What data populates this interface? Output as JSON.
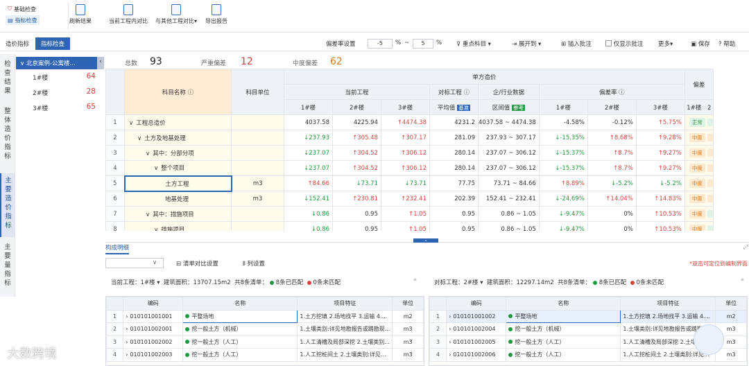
{
  "ribbon": {
    "tabs": [
      {
        "label": "基础检查",
        "active": false
      },
      {
        "label": "指标检查",
        "active": true
      }
    ],
    "buttons": [
      "刷新结果",
      "当前工程内对比",
      "与其他工程对比",
      "导出报告"
    ]
  },
  "toolbar": {
    "tab_cost": "造价指标",
    "tab_check": "指标检查",
    "deviation_label": "偏差率设置",
    "dev_from": "-5",
    "dev_to": "5",
    "pct": "%",
    "tilde": "~",
    "key_subject": "重点科目",
    "expand_to": "展开到",
    "insert_note": "插入批注",
    "only_show_note": "仅显示批注",
    "more": "更多",
    "save": "保存",
    "help": "帮助"
  },
  "left_tabs": [
    "检查结果",
    "整体造价指标",
    "主要造价指标",
    "主要量指标"
  ],
  "tree": {
    "project": "北京案例-公寓楼...",
    "items": [
      {
        "name": "1#楼",
        "count": "64"
      },
      {
        "name": "2#楼",
        "count": "28"
      },
      {
        "name": "3#楼",
        "count": "65"
      }
    ]
  },
  "stats": {
    "total_label": "总数",
    "total": "93",
    "serious_label": "严重偏差",
    "serious": "12",
    "moderate_label": "中度偏差",
    "moderate": "62"
  },
  "grid": {
    "headers": {
      "name": "科目名称",
      "unit": "科目单位",
      "unit_cost": "单方造价",
      "current": "当前工程",
      "compare": "对标工程",
      "industry": "企/行业数据",
      "deviation": "偏差率",
      "deviation2": "偏差",
      "b1": "1#楼",
      "b2": "2#楼",
      "b3": "3#楼",
      "avg": "平均值",
      "avg_badge": "基准",
      "range": "区间值",
      "range_badge": "参考",
      "b2b": "2"
    },
    "rows": [
      {
        "no": "1",
        "indent": 0,
        "exp": "∨",
        "name": "工程总造价",
        "unit": "",
        "c1": "4037.58",
        "c1d": "",
        "c2": "4225.94",
        "c2d": "",
        "c3": "4474.38",
        "c3d": "up",
        "avg": "4231.2",
        "range": "4037.58 ~ 4474.38",
        "r1": "-4.58%",
        "r1d": "",
        "r2": "-0.12%",
        "r2d": "",
        "r3": "5.75%",
        "r3d": "up",
        "tag": "正常",
        "tagc": "ok",
        "extra": "ok"
      },
      {
        "no": "2",
        "indent": 1,
        "exp": "∨",
        "name": "土方及地基处理",
        "unit": "",
        "c1": "237.93",
        "c1d": "dn",
        "c2": "305.48",
        "c2d": "up",
        "c3": "307.17",
        "c3d": "up",
        "avg": "281.09",
        "range": "237.93 ~ 307.17",
        "r1": "-15.35%",
        "r1d": "dn",
        "r2": "8.68%",
        "r2d": "up",
        "r3": "9.28%",
        "r3d": "up",
        "tag": "中度",
        "tagc": "mid",
        "extra": "mid"
      },
      {
        "no": "3",
        "indent": 2,
        "exp": "∨",
        "name": "其中：分部分项",
        "unit": "",
        "c1": "237.07",
        "c1d": "dn",
        "c2": "304.52",
        "c2d": "up",
        "c3": "306.12",
        "c3d": "up",
        "avg": "280.14",
        "range": "237.07 ~ 306.12",
        "r1": "-15.37%",
        "r1d": "dn",
        "r2": "8.7%",
        "r2d": "up",
        "r3": "9.27%",
        "r3d": "up",
        "tag": "中度",
        "tagc": "mid",
        "extra": "mid"
      },
      {
        "no": "4",
        "indent": 3,
        "exp": "∨",
        "name": "整个项目",
        "unit": "",
        "c1": "237.07",
        "c1d": "dn",
        "c2": "304.52",
        "c2d": "up",
        "c3": "306.12",
        "c3d": "up",
        "avg": "280.14",
        "range": "237.07 ~ 306.12",
        "r1": "-15.37%",
        "r1d": "dn",
        "r2": "8.7%",
        "r2d": "up",
        "r3": "9.27%",
        "r3d": "up",
        "tag": "中度",
        "tagc": "mid",
        "extra": "mid"
      },
      {
        "no": "5",
        "indent": 4,
        "exp": "",
        "name": "土方工程",
        "unit": "m3",
        "c1": "84.66",
        "c1d": "up",
        "c2": "73.71",
        "c2d": "dn",
        "c3": "73.71",
        "c3d": "dn",
        "avg": "77.75",
        "range": "73.71 ~ 84.66",
        "r1": "8.89%",
        "r1d": "up",
        "r2": "-5.2%",
        "r2d": "dn",
        "r3": "-5.2%",
        "r3d": "dn",
        "tag": "中度",
        "tagc": "mid",
        "extra": "mid"
      },
      {
        "no": "6",
        "indent": 4,
        "exp": "",
        "name": "地基处理",
        "unit": "m3",
        "c1": "152.41",
        "c1d": "dn",
        "c2": "230.81",
        "c2d": "up",
        "c3": "232.41",
        "c3d": "up",
        "avg": "202.39",
        "range": "152.41 ~ 232.41",
        "r1": "-24.69%",
        "r1d": "dn",
        "r2": "14.04%",
        "r2d": "up",
        "r3": "14.83%",
        "r3d": "up",
        "tag": "中度",
        "tagc": "mid",
        "extra": "mid"
      },
      {
        "no": "7",
        "indent": 2,
        "exp": "∨",
        "name": "其中：措施项目",
        "unit": "",
        "c1": "0.86",
        "c1d": "dn",
        "c2": "0.95",
        "c2d": "",
        "c3": "1.05",
        "c3d": "up",
        "avg": "0.95",
        "range": "0.86 ~ 1.05",
        "r1": "-9.47%",
        "r1d": "dn",
        "r2": "0%",
        "r2d": "",
        "r3": "10.53%",
        "r3d": "up",
        "tag": "中度",
        "tagc": "mid",
        "extra": "ok"
      },
      {
        "no": "8",
        "indent": 3,
        "exp": "∨",
        "name": "措施项目",
        "unit": "",
        "c1": "0.86",
        "c1d": "dn",
        "c2": "0.95",
        "c2d": "",
        "c3": "1.05",
        "c3d": "up",
        "avg": "0.95",
        "range": "0.86 ~ 1.05",
        "r1": "-9.47%",
        "r1d": "dn",
        "r2": "0%",
        "r2d": "",
        "r3": "10.53%",
        "r3d": "up",
        "tag": "中度",
        "tagc": "mid",
        "extra": "ok"
      }
    ]
  },
  "detail": {
    "tab": "构成明细",
    "list_compare": "清单对比设置",
    "col_settings": "列设置",
    "hint": "*双击可定位到编制界面",
    "left": {
      "cur_label": "当前工程：",
      "cur": "1#楼",
      "area_label": "建筑面积：",
      "area": "13707.15m2",
      "total": "共8条清单：",
      "matched": "8条已匹配",
      "unmatched": "0条未匹配"
    },
    "right": {
      "cur_label": "对标工程：",
      "cur": "2#楼",
      "area_label": "建筑面积：",
      "area": "12297.14m2",
      "total": "共8条清单：",
      "matched": "8条已匹配",
      "unmatched": "0条未匹配"
    },
    "headers": {
      "code": "编码",
      "name": "名称",
      "feature": "项目特征",
      "unit": "单位"
    },
    "left_rows": [
      {
        "no": "1",
        "code": "010101001001",
        "name": "平整场地",
        "feature": "1.土方挖填 2.场地找平 3.运输 4....",
        "unit": "m2"
      },
      {
        "no": "2",
        "code": "010101002001",
        "name": "挖一般土方（机械）",
        "feature": "1.土壤类别:详见地勘报告或踏勘现...",
        "unit": "m3"
      },
      {
        "no": "3",
        "code": "010101002002",
        "name": "挖一般土方（人工）",
        "feature": "1.人工清槽及局部深挖 2.土壤类别...",
        "unit": "m3"
      },
      {
        "no": "4",
        "code": "010101002003",
        "name": "挖一般土方（人工）",
        "feature": "1.人工挖桩间土 2.土壤类别:详见...",
        "unit": "m3"
      }
    ],
    "right_rows": [
      {
        "no": "1",
        "code": "010101001002",
        "name": "平整场地",
        "feature": "1.土方挖填 2.场地找平 3.运输 4....",
        "unit": "m2"
      },
      {
        "no": "2",
        "code": "010101002004",
        "name": "挖一般土方（机械）",
        "feature": "1.土壤类别:详见地勘报告或踏勘现...",
        "unit": "m3"
      },
      {
        "no": "3",
        "code": "010101002005",
        "name": "挖一般土方（人工）",
        "feature": "1.人工清槽及局部深挖 2.土壤类别...",
        "unit": "m3"
      },
      {
        "no": "4",
        "code": "010101002006",
        "name": "挖一般土方（人工）",
        "feature": "1.人工挖桩间土 2.土壤类别:详见...",
        "unit": "m3"
      }
    ]
  },
  "watermark": "大数跨境",
  "colors": {
    "primary": "#2d64b4",
    "up": "#d9433a",
    "down": "#1c9a3e",
    "orange": "#e07a1f",
    "match": "#1c9a3e",
    "nomatch": "#d9433a"
  }
}
